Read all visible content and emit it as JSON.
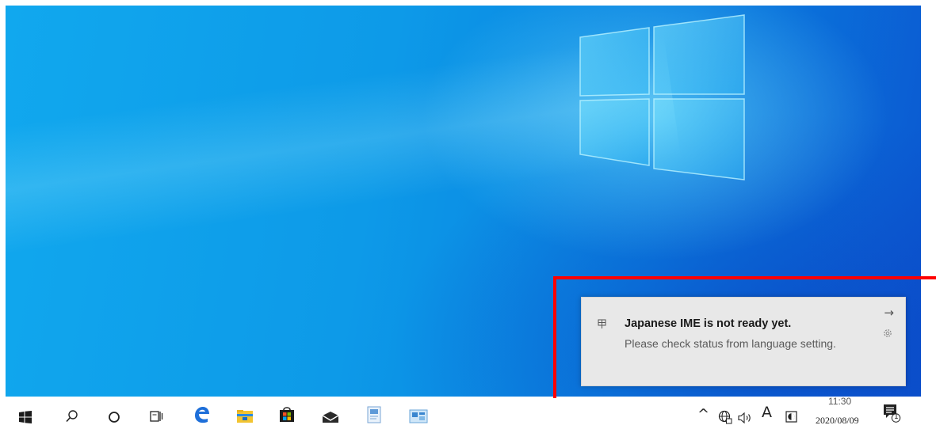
{
  "desktop": {
    "logo": "windows-logo"
  },
  "notification": {
    "title": "Japanese IME is not ready yet.",
    "body": "Please check status from language setting.",
    "app_icon": "ime-icon",
    "dismiss_icon": "arrow-right-icon",
    "settings_icon": "gear-icon",
    "arrow_glyph": "→"
  },
  "taskbar": {
    "items": [
      "start-icon",
      "search-icon",
      "cortana-icon",
      "task-view-icon",
      "edge-icon",
      "file-explorer-icon",
      "store-icon",
      "mail-icon",
      "app-icon",
      "app-icon-2"
    ],
    "tray": {
      "chevron": "^",
      "ime_mode": "A",
      "time": "11:30",
      "date": "2020/08/09",
      "notification_count": "1"
    }
  },
  "colors": {
    "highlight": "#ff0000",
    "desktop_blue": "#0d9ae8",
    "notification_bg": "#e8e8e8"
  }
}
